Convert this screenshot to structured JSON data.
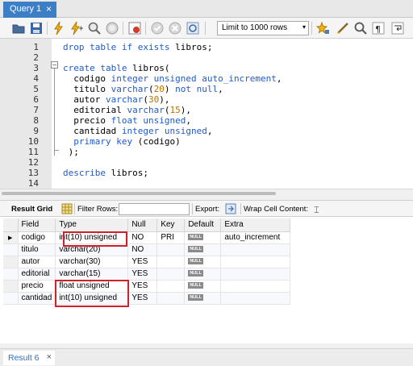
{
  "query_tab": {
    "label": "Query 1",
    "close": "×"
  },
  "toolbar": {
    "limit_label": "Limit to 1000 rows",
    "limit_arrow": "▾"
  },
  "editor": {
    "lines": [
      {
        "n": "1",
        "code": "drop table if exists libros;"
      },
      {
        "n": "2",
        "code": ""
      },
      {
        "n": "3",
        "code": "create table libros("
      },
      {
        "n": "4",
        "code": "  codigo integer unsigned auto_increment,"
      },
      {
        "n": "5",
        "code": "  titulo varchar(20) not null,"
      },
      {
        "n": "6",
        "code": "  autor varchar(30),"
      },
      {
        "n": "7",
        "code": "  editorial varchar(15),"
      },
      {
        "n": "8",
        "code": "  precio float unsigned,"
      },
      {
        "n": "9",
        "code": "  cantidad integer unsigned,"
      },
      {
        "n": "10",
        "code": "  primary key (codigo)"
      },
      {
        "n": "11",
        "code": " );"
      },
      {
        "n": "12",
        "code": ""
      },
      {
        "n": "13",
        "code": "describe libros;"
      },
      {
        "n": "14",
        "code": ""
      }
    ]
  },
  "results_toolbar": {
    "result_grid": "Result Grid",
    "filter_rows": "Filter Rows:",
    "export": "Export:",
    "wrap": "Wrap Cell Content:"
  },
  "grid": {
    "columns": [
      "Field",
      "Type",
      "Null",
      "Key",
      "Default",
      "Extra"
    ],
    "null_badge": "NULL",
    "rows": [
      {
        "field": "codigo",
        "type": "int(10) unsigned",
        "null": "NO",
        "key": "PRI",
        "extra": "auto_increment"
      },
      {
        "field": "titulo",
        "type": "varchar(20)",
        "null": "NO",
        "key": "",
        "extra": ""
      },
      {
        "field": "autor",
        "type": "varchar(30)",
        "null": "YES",
        "key": "",
        "extra": ""
      },
      {
        "field": "editorial",
        "type": "varchar(15)",
        "null": "YES",
        "key": "",
        "extra": ""
      },
      {
        "field": "precio",
        "type": "float unsigned",
        "null": "YES",
        "key": "",
        "extra": ""
      },
      {
        "field": "cantidad",
        "type": "int(10) unsigned",
        "null": "YES",
        "key": "",
        "extra": ""
      }
    ],
    "row_marker": "▶"
  },
  "bottom_tab": {
    "label": "Result 6",
    "close": "×"
  },
  "colors": {
    "tab_active": "#3d7fc6",
    "keyword": "#1e5bcc",
    "number": "#c07000",
    "highlight": "#d0212b"
  }
}
